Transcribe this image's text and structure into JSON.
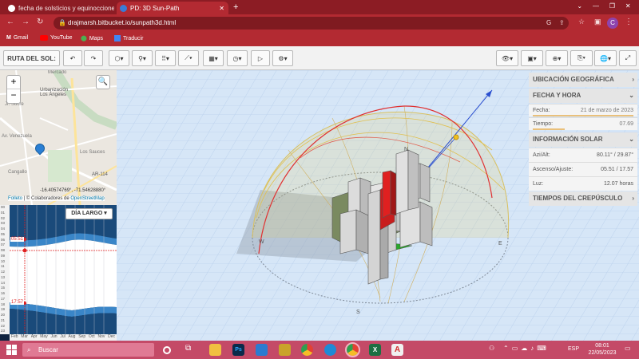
{
  "browser": {
    "tabs": [
      {
        "title": "fecha de solsticios y equinocciones"
      },
      {
        "title": "PD: 3D Sun-Path"
      }
    ],
    "url": "drajmarsh.bitbucket.io/sunpath3d.html",
    "bookmarks": [
      "Gmail",
      "YouTube",
      "Maps",
      "Traducir"
    ],
    "profile": "C"
  },
  "toolbar": {
    "route_label": "RUTA DEL SOL:"
  },
  "map": {
    "labels": [
      "Urbanización Los Ángeles",
      "AR-114",
      "Mercado",
      "Jr. Sucre",
      "Av. Venezuela",
      "Los Sauces",
      "Cangallo"
    ],
    "coords": "-16.40574769°, -71.54628880°",
    "attribution_link": "Folleto",
    "attribution_text": "| © Colaboradores de",
    "attribution_osm": "OpenStreetMap",
    "zoom_in": "+",
    "zoom_out": "−"
  },
  "sunchart": {
    "button": "DÍA LARGO",
    "hours": [
      "00",
      "01",
      "02",
      "03",
      "04",
      "05",
      "06",
      "07",
      "08",
      "09",
      "10",
      "11",
      "12",
      "13",
      "14",
      "15",
      "16",
      "17",
      "18",
      "19",
      "20",
      "21",
      "22",
      "23"
    ],
    "months": [
      "Feb",
      "Mar",
      "Apr",
      "May",
      "Jun",
      "Jul",
      "Aug",
      "Sep",
      "Oct",
      "Nov",
      "Dec"
    ],
    "sunrise": "05:51",
    "sunset": "17:57"
  },
  "info": {
    "geo": "UBICACIÓN GEOGRÁFICA",
    "datetime": "FECHA Y HORA",
    "date_label": "Fecha:",
    "date_value": "21 de marzo de 2023",
    "time_label": "Tiempo:",
    "time_value": "07.69",
    "solar": "INFORMACIÓN SOLAR",
    "azalt_label": "Azi/Alt:",
    "azalt_value": "80.11° / 29.87°",
    "rise_label": "Ascenso/Ajuste:",
    "rise_value": "05.51 / 17.57",
    "light_label": "Luz:",
    "light_value": "12.07 horas",
    "twilight": "TIEMPOS DEL CREPÚSCULO"
  },
  "scene": {
    "compass": [
      "N",
      "E",
      "S",
      "W"
    ]
  },
  "taskbar": {
    "search": "Buscar",
    "lang": "ESP",
    "time": "08:01",
    "date": "22/05/2023"
  },
  "colors": {
    "browser_red": "#b32a32",
    "scene_bg": "#d9e8f8",
    "taskbar": "#c44a67",
    "sun_path_red": "#e03030",
    "dome": "#e8c84a"
  }
}
